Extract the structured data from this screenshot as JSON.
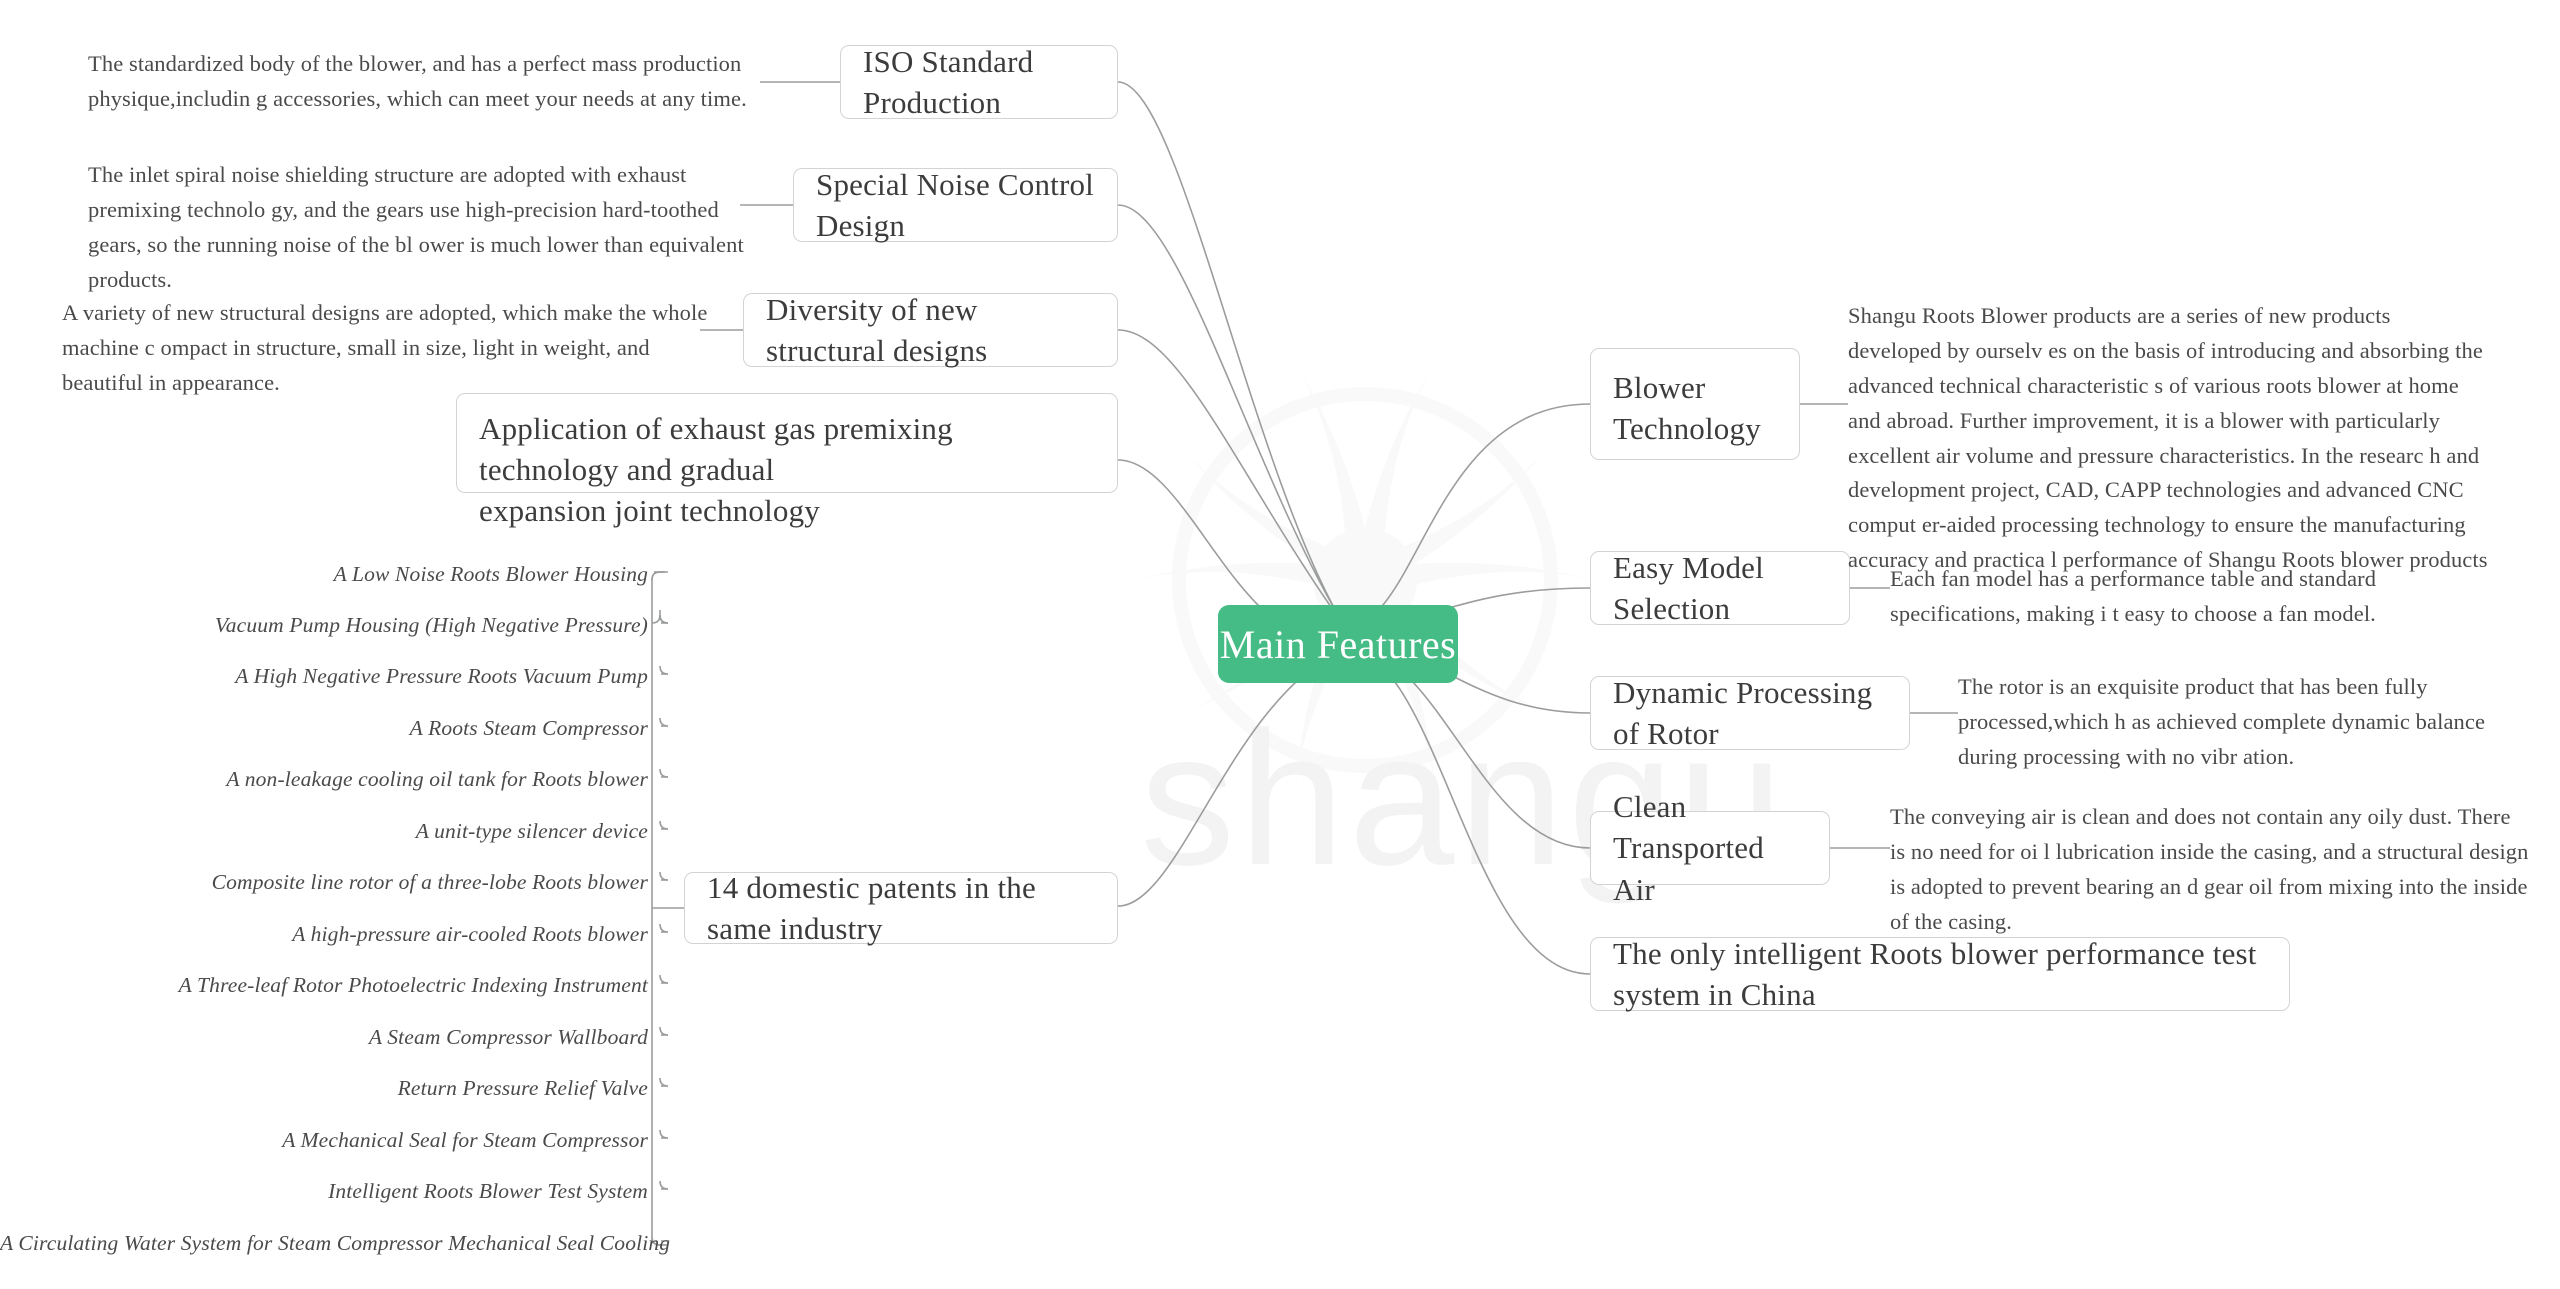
{
  "colors": {
    "center_node_bg": "#45bb85",
    "center_node_text": "#ffffff",
    "node_border": "#d2d4d3",
    "node_bg": "#ffffff",
    "text": "#3c3c3c",
    "connector": "#9b9d9c",
    "watermark": "#f2f3f2",
    "page_bg": "#ffffff"
  },
  "center": {
    "label": "Main Features"
  },
  "watermark": {
    "text": "shangu",
    "logo_name": "fan-impeller-logo"
  },
  "left_branches": [
    {
      "id": "iso-standard-production",
      "label": "ISO Standard Production",
      "description": "The standardized body of the blower, and has a perfect mass production physique,including accessories, which can meet your needs at any time.",
      "description_lines": [
        "The standardized body of the blower, and has a perfect mass production physique,includin",
        "g accessories, which can meet your needs at any time."
      ]
    },
    {
      "id": "special-noise-control-design",
      "label": "Special Noise Control Design",
      "description": "The inlet spiral noise shielding structure are adopted with exhaust premixing technology, and the gears use high-precision hard-toothed gears, so the running noise of the blower is much lower than equivalent products.",
      "description_lines": [
        "The inlet spiral noise shielding structure are adopted with exhaust premixing technolo",
        "gy, and the gears use high-precision hard-toothed gears, so the running noise of the bl",
        "ower is much lower than equivalent products."
      ]
    },
    {
      "id": "diversity-of-new-structural-designs",
      "label": "Diversity of new structural designs",
      "description": "A variety of new structural designs are adopted, which make the whole machine compact in structure, small in size, light in weight, and beautiful in appearance.",
      "description_lines": [
        "A variety of new structural designs are adopted, which make the whole machine c",
        "ompact in structure, small in size, light in weight, and beautiful in appearance."
      ]
    },
    {
      "id": "exhaust-gas-premixing-technology",
      "label_lines": [
        "Application of exhaust gas premixing technology and gradual",
        " expansion joint technology"
      ],
      "label": "Application of exhaust gas premixing technology and gradual expansion joint technology",
      "description": "",
      "description_lines": []
    },
    {
      "id": "domestic-patents",
      "label": "14 domestic patents in the same industry",
      "patents": [
        "A Low Noise Roots Blower Housing",
        "Vacuum Pump Housing (High Negative Pressure)",
        "A High Negative Pressure Roots Vacuum Pump",
        "A Roots Steam Compressor",
        "A non-leakage cooling oil tank for Roots blower",
        "A unit-type silencer device",
        "Composite line rotor of a three-lobe Roots blower",
        "A high-pressure air-cooled Roots blower",
        "A Three-leaf Rotor Photoelectric Indexing Instrument",
        "A Steam Compressor Wallboard",
        "Return Pressure Relief Valve",
        "A Mechanical Seal for Steam Compressor",
        "Intelligent Roots Blower Test System",
        "A Circulating Water System for Steam Compressor Mechanical Seal Cooling"
      ]
    }
  ],
  "right_branches": [
    {
      "id": "blower-technology",
      "label_lines": [
        "Blower",
        "Technology"
      ],
      "label": "Blower Technology",
      "description": "Shangu Roots Blower products are a series of new products developed by ourselves on the basis of introducing and absorbing the advanced technical characteristics of various roots blower at home and abroad. Further improvement, it is a blower with particularly excellent air volume and pressure characteristics. In the research and development project, CAD, CAPP technologies and advanced CNC computer-aided processing technology to ensure the manufacturing accuracy and practical performance of Shangu Roots blower products",
      "description_lines": [
        "Shangu Roots Blower products are a series of new products developed by ourselv",
        "es on the basis of introducing and absorbing the advanced technical characteristic",
        "s of various roots blower at home and abroad. Further improvement, it is a blower",
        "with particularly excellent air volume and pressure characteristics. In the researc",
        "h and development project, CAD, CAPP technologies and advanced CNC comput",
        "er-aided processing technology to ensure the manufacturing accuracy and practica",
        "l performance of Shangu Roots blower products"
      ]
    },
    {
      "id": "easy-model-selection",
      "label": "Easy Model Selection",
      "description": "Each fan model has a performance table and standard specifications, making it easy to choose a fan model.",
      "description_lines": [
        "Each fan model has a performance table and standard specifications, making i",
        "t easy to choose a fan model."
      ]
    },
    {
      "id": "dynamic-processing-of-rotor",
      "label": "Dynamic Processing of Rotor",
      "description": "The rotor is an exquisite product that has been fully processed,which has achieved complete dynamic balance during processing with no vibration.",
      "description_lines": [
        "The rotor is an exquisite product that has been fully processed,which h",
        "as achieved complete dynamic balance during processing with no vibr",
        "ation."
      ]
    },
    {
      "id": "clean-transported-air",
      "label": "Clean Transported Air",
      "description": "The conveying air is clean and does not contain any oily dust. There is no need for oil lubrication inside the casing, and a structural design is adopted to prevent bearing and gear oil from mixing into the inside of the casing.",
      "description_lines": [
        "The conveying air is clean and does not contain any oily dust. There is no need for oi",
        "l lubrication inside the casing, and a structural design is adopted to prevent bearing an",
        "d gear oil from mixing into the inside of the casing."
      ]
    },
    {
      "id": "intelligent-test-system",
      "label": "The only intelligent Roots blower performance test system in China",
      "description": "",
      "description_lines": []
    }
  ]
}
